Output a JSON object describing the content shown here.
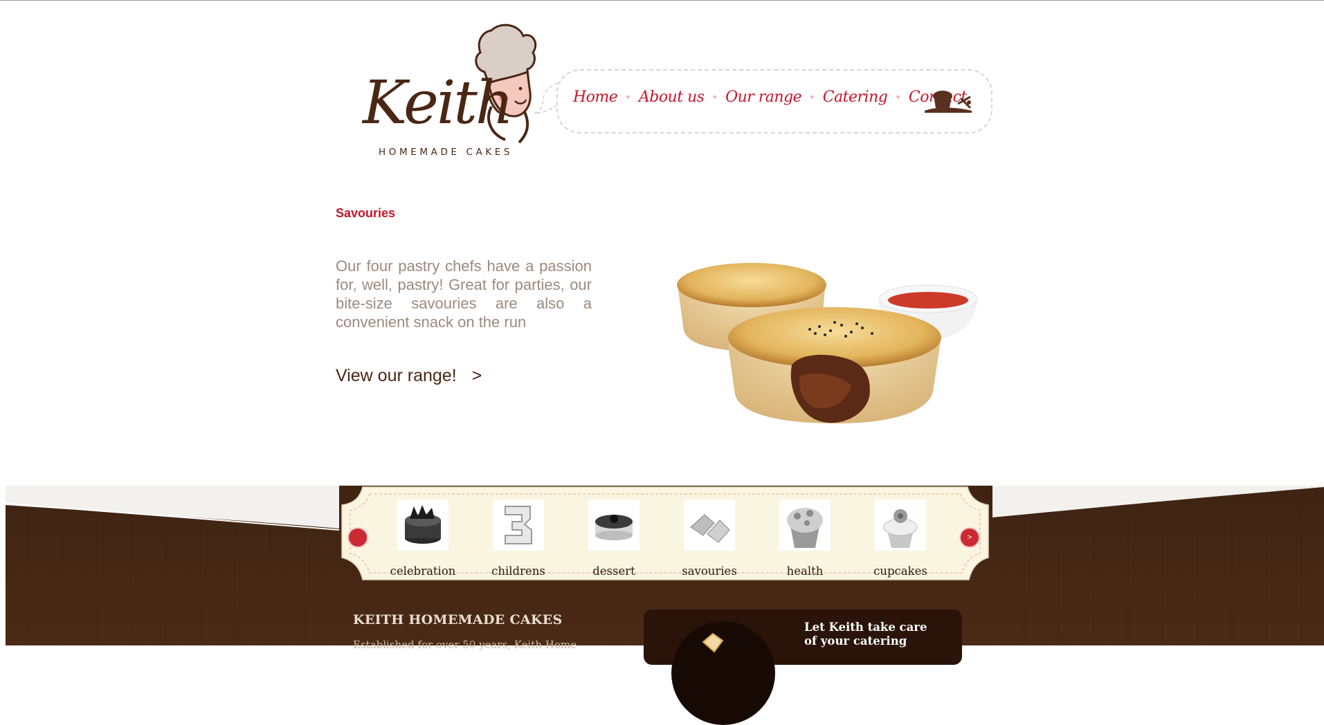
{
  "header": {
    "logo_word": "Keith",
    "logo_tagline": "HOMEMADE CAKES",
    "nav": [
      {
        "label": "Home"
      },
      {
        "label": "About us"
      },
      {
        "label": "Our range"
      },
      {
        "label": "Catering"
      },
      {
        "label": "Contact"
      }
    ],
    "cart_icon": "chef-cart-icon"
  },
  "feature": {
    "title": "Savouries",
    "description": "Our four pastry chefs have a passion for, well, pastry! Great for parties, our bite-size savouries are also a convenient snack on the run",
    "cta_label": "View our range!",
    "cta_arrow": ">",
    "image_icon": "meat-pie-image"
  },
  "carousel": {
    "prev_label": "",
    "next_label": ">",
    "items": [
      {
        "label": "celebration",
        "icon": "celebration-cake-thumb"
      },
      {
        "label": "childrens",
        "icon": "number-cake-thumb"
      },
      {
        "label": "dessert",
        "icon": "cheesecake-thumb"
      },
      {
        "label": "savouries",
        "icon": "pastry-thumb"
      },
      {
        "label": "health",
        "icon": "muffin-thumb"
      },
      {
        "label": "cupcakes",
        "icon": "cupcake-thumb"
      }
    ]
  },
  "footer": {
    "about_title": "KEITH HOMEMADE CAKES",
    "about_text": "Established for over 50 years, Keith Home",
    "catering_title": "Let Keith take care of your catering"
  },
  "colors": {
    "brand_red": "#c4162a",
    "brand_brown": "#4a2614",
    "band_brown": "#3f2413",
    "carousel_cream": "#faf5e0"
  }
}
